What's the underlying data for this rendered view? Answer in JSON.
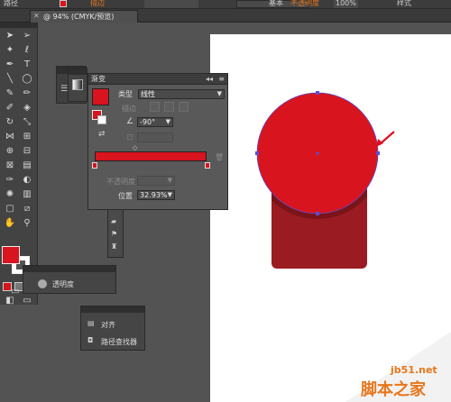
{
  "topbar": {
    "doc_label": "路径",
    "stroke_label": "描边",
    "line_label": "基本",
    "opacity_label": "不透明度",
    "opacity_value": "100%",
    "style_label": "样式"
  },
  "tab": {
    "title": "@ 94% (CMYK/预览)"
  },
  "gradient_panel": {
    "title": "渐变",
    "type_label": "类型",
    "type_value": "线性",
    "stroke_label": "描边",
    "angle_value": "-90°",
    "opacity_label": "不透明度",
    "location_label": "位置",
    "location_value": "32.93%"
  },
  "transparency_panel": {
    "label": "透明度"
  },
  "align_panel": {
    "align_label": "对齐",
    "pathfinder_label": "路径查找器"
  },
  "watermark": {
    "site": "jb51.net",
    "logo": "脚本之家"
  },
  "colors": {
    "fill": "#d8141e",
    "rect": "#9a1c22",
    "arrow": "#e01020"
  }
}
